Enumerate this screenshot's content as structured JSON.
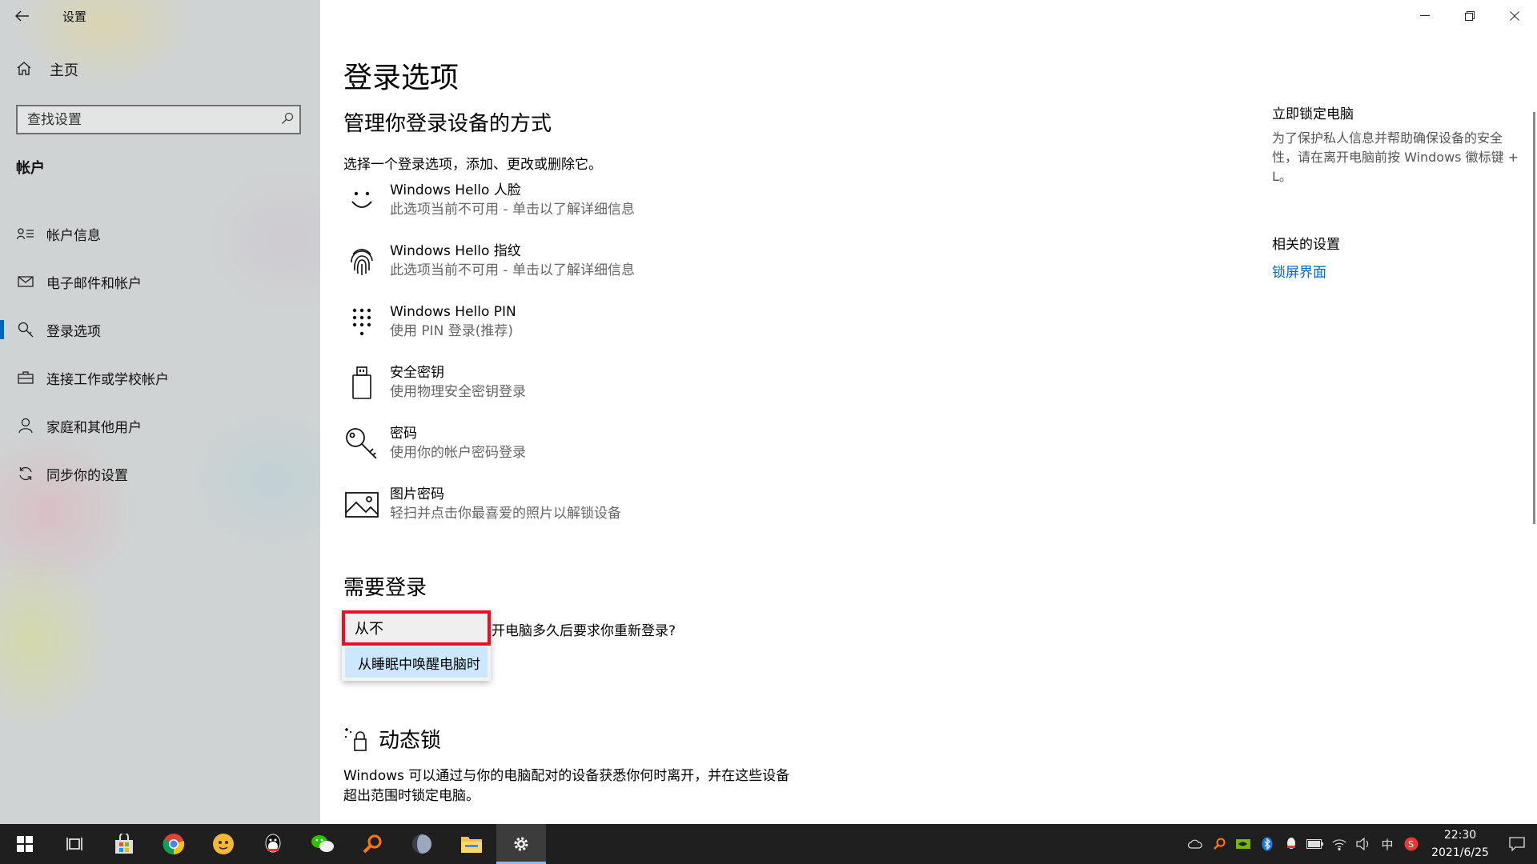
{
  "window": {
    "title": "设置"
  },
  "sidebar": {
    "home_label": "主页",
    "search_placeholder": "查找设置",
    "section_title": "帐户",
    "items": [
      {
        "label": "帐户信息",
        "icon": "account-info-icon"
      },
      {
        "label": "电子邮件和帐户",
        "icon": "mail-icon"
      },
      {
        "label": "登录选项",
        "icon": "key-icon",
        "active": true
      },
      {
        "label": "连接工作或学校帐户",
        "icon": "briefcase-icon"
      },
      {
        "label": "家庭和其他用户",
        "icon": "person-icon"
      },
      {
        "label": "同步你的设置",
        "icon": "sync-icon"
      }
    ]
  },
  "main": {
    "title": "登录选项",
    "subtitle": "管理你登录设备的方式",
    "description": "选择一个登录选项，添加、更改或删除它。",
    "options": [
      {
        "title": "Windows Hello 人脸",
        "subtitle": "此选项当前不可用 - 单击以了解详细信息",
        "icon": "face-icon"
      },
      {
        "title": "Windows Hello 指纹",
        "subtitle": "此选项当前不可用 - 单击以了解详细信息",
        "icon": "fingerprint-icon"
      },
      {
        "title": "Windows Hello PIN",
        "subtitle": "使用 PIN 登录(推荐)",
        "icon": "pin-icon"
      },
      {
        "title": "安全密钥",
        "subtitle": "使用物理安全密钥登录",
        "icon": "usb-key-icon"
      },
      {
        "title": "密码",
        "subtitle": "使用你的帐户密码登录",
        "icon": "password-key-icon"
      },
      {
        "title": "图片密码",
        "subtitle": "轻扫并点击你最喜爱的照片以解锁设备",
        "icon": "picture-icon"
      }
    ],
    "require_signin": {
      "title": "需要登录",
      "question": "开电脑多久后要求你重新登录?",
      "selected": "从不",
      "option": "从睡眠中唤醒电脑时"
    },
    "dynamic_lock": {
      "title": "动态锁",
      "description": "Windows 可以通过与你的电脑配对的设备获悉你何时离开，并在这些设备超出范围时锁定电脑。"
    }
  },
  "right": {
    "lock_title": "立即锁定电脑",
    "lock_desc": "为了保护私人信息并帮助确保设备的安全性，请在离开电脑前按 Windows 徽标键 + L。",
    "related_title": "相关的设置",
    "related_link": "锁屏界面"
  },
  "taskbar": {
    "time": "22:30",
    "date": "2021/6/25",
    "ime": "中",
    "apps": [
      "start-icon",
      "task-view-icon",
      "store-icon",
      "chrome-icon",
      "app-icon",
      "qq-icon",
      "wechat-icon",
      "search-app-icon",
      "browser-icon",
      "file-explorer-icon",
      "settings-icon"
    ]
  },
  "colors": {
    "accent": "#0067c0",
    "highlight": "#e81123",
    "dropdown_option_bg": "#cce8ff"
  }
}
